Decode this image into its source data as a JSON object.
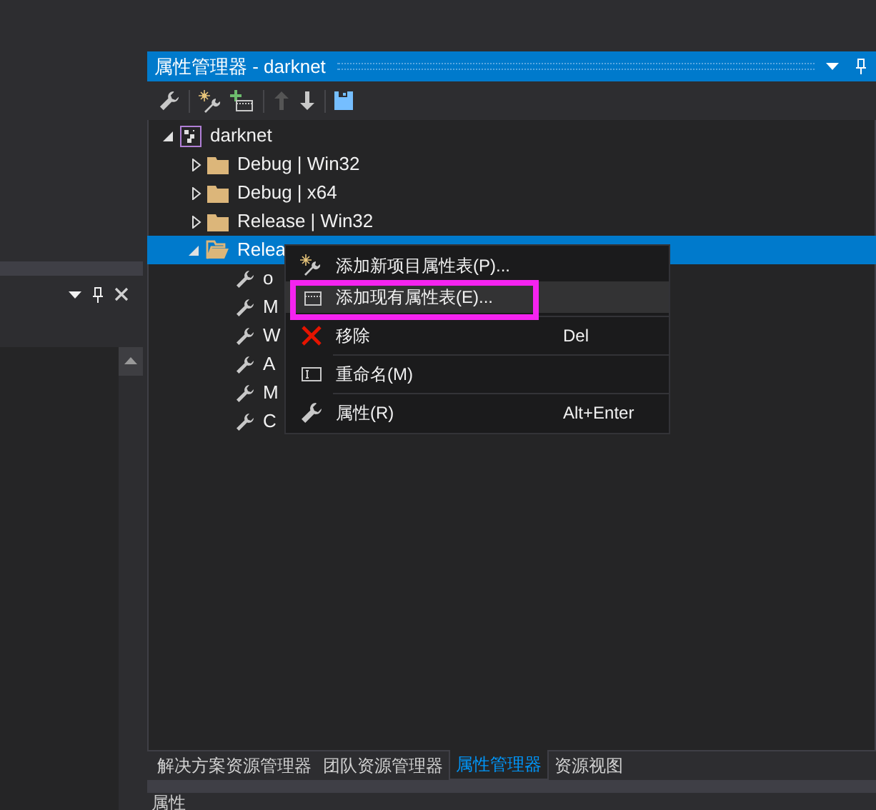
{
  "panel": {
    "title": "属性管理器 - darknet"
  },
  "tree": [
    {
      "label": "darknet",
      "expanded": true,
      "selected": false,
      "children": [
        {
          "label": "Debug | Win32",
          "expanded": false,
          "selected": false
        },
        {
          "label": "Debug | x64",
          "expanded": false,
          "selected": false
        },
        {
          "label": "Release | Win32",
          "expanded": false,
          "selected": false
        },
        {
          "label": "Relea",
          "expanded": true,
          "selected": true,
          "children": [
            {
              "label": "o",
              "selected": false
            },
            {
              "label": "M",
              "selected": false
            },
            {
              "label": "W",
              "selected": false
            },
            {
              "label": "A",
              "selected": false
            },
            {
              "label": "M",
              "selected": false
            },
            {
              "label": "C",
              "selected": false
            }
          ]
        }
      ]
    }
  ],
  "context_menu": [
    {
      "kind": "item",
      "label": "添加新项目属性表(P)...",
      "selected": false
    },
    {
      "kind": "item",
      "label": "添加现有属性表(E)...",
      "selected": true
    },
    {
      "kind": "separator"
    },
    {
      "kind": "item",
      "label": "移除",
      "shortcut": "Del",
      "selected": false
    },
    {
      "kind": "separator"
    },
    {
      "kind": "item",
      "label": "重命名(M)",
      "selected": false
    },
    {
      "kind": "separator"
    },
    {
      "kind": "item",
      "label": "属性(R)",
      "shortcut": "Alt+Enter",
      "selected": false
    }
  ],
  "tabs": [
    {
      "label": "解决方案资源管理器",
      "selected": false
    },
    {
      "label": "团队资源管理器",
      "selected": false
    },
    {
      "label": "属性管理器",
      "selected": true
    },
    {
      "label": "资源视图",
      "selected": false
    }
  ],
  "bottom_panel": {
    "title": "属性"
  }
}
